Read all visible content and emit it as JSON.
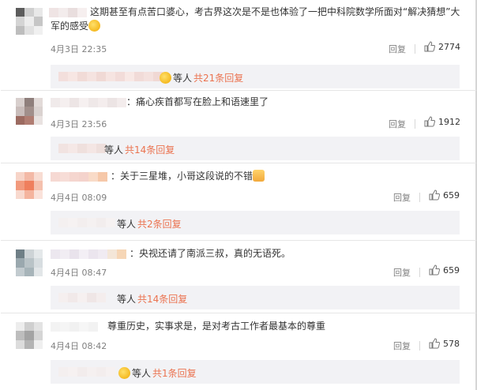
{
  "comments": [
    {
      "text": "这期甚至有点苦口婆心，考古界这次是不是也体验了一把中科院数学所面对“解决猜想”大",
      "text2": "军的感受",
      "time": "4月3日 22:35",
      "reply_label": "回复",
      "likes": "2774",
      "sub_who": "等人",
      "sub_total": "共21条回复"
    },
    {
      "text": "：痛心疾首都写在脸上和语速里了",
      "time": "4月3日 23:56",
      "reply_label": "回复",
      "likes": "1912",
      "sub_who": "等人",
      "sub_total": "共14条回复"
    },
    {
      "text": "：关于三星堆，小哥这段说的不错",
      "time": "4月4日 08:09",
      "reply_label": "回复",
      "likes": "659",
      "sub_who": "等人",
      "sub_total": "共2条回复"
    },
    {
      "text": "：央视还请了南派三叔，真的无语死。",
      "time": "4月4日 08:47",
      "reply_label": "回复",
      "likes": "659",
      "sub_who": "等人",
      "sub_total": "共14条回复"
    },
    {
      "text": "尊重历史，实事求是，是对考古工作者最基本的尊重",
      "time": "4月4日 08:42",
      "reply_label": "回复",
      "likes": "578",
      "sub_who": "等人",
      "sub_total": "共1条回复"
    }
  ],
  "icons": {
    "like": "thumbs-up-icon",
    "laugh": "laughing-emoji-icon",
    "thumb": "thumbs-up-emoji-icon"
  },
  "colors": {
    "meta_text": "#808080",
    "reply_total": "#eb7350",
    "subreply_bg": "#f2f2f5"
  }
}
